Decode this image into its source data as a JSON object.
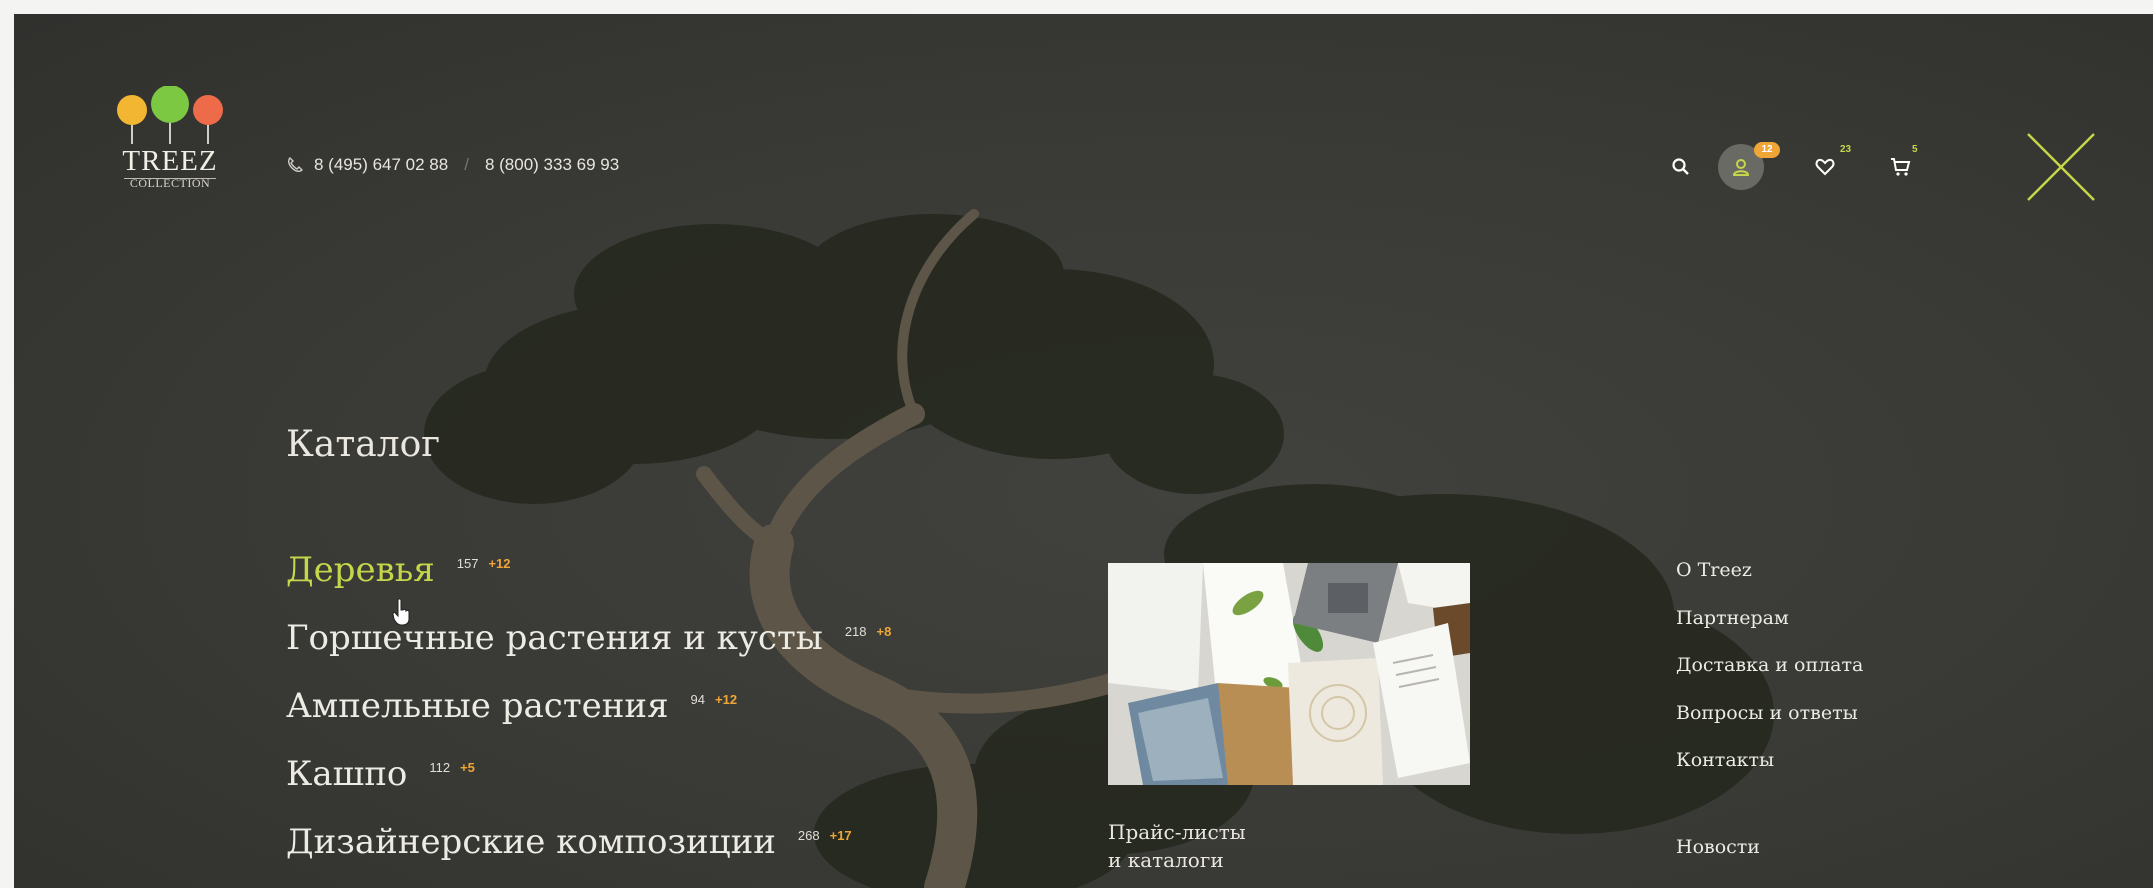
{
  "header": {
    "logo": {
      "brand": "TREEZ",
      "sub": "COLLECTION"
    },
    "phones": [
      "8 (495) 647 02 88",
      "8 (800) 333 69 93"
    ],
    "phone_separator": "/",
    "icons": {
      "search": "search-icon",
      "account": {
        "icon": "user-icon",
        "badge": "12"
      },
      "favorites": {
        "icon": "heart-icon",
        "badge": "23"
      },
      "cart": {
        "icon": "cart-icon",
        "badge": "5"
      },
      "close": "close-icon"
    }
  },
  "catalog": {
    "title": "Каталог",
    "items": [
      {
        "name": "Деревья",
        "count": "157",
        "plus": "+12",
        "active": true
      },
      {
        "name": "Горшечные растения и кусты",
        "count": "218",
        "plus": "+8",
        "active": false
      },
      {
        "name": "Ампельные растения",
        "count": "94",
        "plus": "+12",
        "active": false
      },
      {
        "name": "Кашпо",
        "count": "112",
        "plus": "+5",
        "active": false
      },
      {
        "name": "Дизайнерские композиции",
        "count": "268",
        "plus": "+17",
        "active": false
      }
    ]
  },
  "price_card": {
    "caption_line1": "Прайс-листы",
    "caption_line2": "и каталоги"
  },
  "side_nav": {
    "items": [
      "О Treez",
      "Партнерам",
      "Доставка и оплата",
      "Вопросы и ответы",
      "Контакты"
    ],
    "news": "Новости"
  },
  "colors": {
    "accent": "#c6d64a",
    "badge": "#f0a636",
    "background": "#393935",
    "text": "#ecebe4"
  }
}
